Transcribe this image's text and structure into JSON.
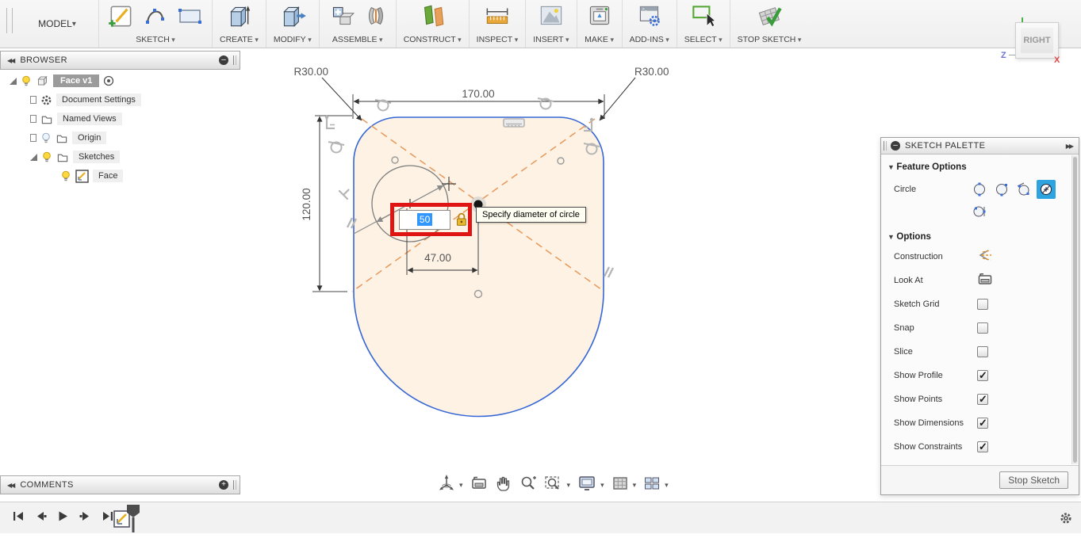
{
  "toolbar": {
    "model_label": "MODEL",
    "groups": [
      {
        "label": "SKETCH"
      },
      {
        "label": "CREATE"
      },
      {
        "label": "MODIFY"
      },
      {
        "label": "ASSEMBLE"
      },
      {
        "label": "CONSTRUCT"
      },
      {
        "label": "INSPECT"
      },
      {
        "label": "INSERT"
      },
      {
        "label": "MAKE"
      },
      {
        "label": "ADD-INS"
      },
      {
        "label": "SELECT"
      },
      {
        "label": "STOP SKETCH"
      }
    ],
    "icon_names": [
      "create-sketch-icon",
      "spline-icon",
      "rectangle-icon",
      "extrude-icon",
      "press-pull-icon",
      "new-component-icon",
      "joint-icon",
      "construction-plane-icon",
      "measure-icon",
      "insert-image-icon",
      "3d-print-icon",
      "scripts-addins-icon",
      "window-select-icon",
      "stop-sketch-icon"
    ]
  },
  "viewcube": {
    "face_label": "RIGHT",
    "z_label": "Z",
    "x_label": "X"
  },
  "browser": {
    "title": "BROWSER",
    "root_label": "Face v1",
    "items": [
      {
        "label": "Document Settings"
      },
      {
        "label": "Named Views"
      },
      {
        "label": "Origin"
      },
      {
        "label": "Sketches"
      },
      {
        "label": "Face"
      }
    ]
  },
  "comments": {
    "title": "COMMENTS"
  },
  "sketch": {
    "width_dim": "170.00",
    "height_dim": "120.00",
    "offset_dim": "47.00",
    "radius_dim_left": "R30.00",
    "radius_dim_right": "R30.00",
    "input_value": "50",
    "tooltip": "Specify diameter of circle"
  },
  "palette": {
    "title": "SKETCH PALETTE",
    "feature_section": "Feature Options",
    "feature_label": "Circle",
    "circle_options": [
      "center-diameter-circle",
      "two-point-circle",
      "three-point-circle",
      "two-tangent-circle",
      "three-tangent-circle"
    ],
    "selected_circle_option": 3,
    "options_section": "Options",
    "options": [
      {
        "label": "Construction",
        "type": "icon"
      },
      {
        "label": "Look At",
        "type": "icon"
      },
      {
        "label": "Sketch Grid",
        "checked": false
      },
      {
        "label": "Snap",
        "checked": false
      },
      {
        "label": "Slice",
        "checked": false
      },
      {
        "label": "Show Profile",
        "checked": true
      },
      {
        "label": "Show Points",
        "checked": true
      },
      {
        "label": "Show Dimensions",
        "checked": true
      },
      {
        "label": "Show Constraints",
        "checked": true
      }
    ],
    "stop_button": "Stop Sketch"
  },
  "nav_icons": [
    "orbit-icon",
    "look-at-icon",
    "pan-icon",
    "zoom-icon",
    "fit-icon",
    "display-settings-icon",
    "grid-settings-icon",
    "viewports-icon"
  ],
  "timeline_icons": [
    "go-to-start-icon",
    "step-back-icon",
    "play-icon",
    "step-forward-icon",
    "go-to-end-icon",
    "sketch-feature-icon",
    "timeline-marker",
    "gear-icon"
  ],
  "colors": {
    "accent_blue": "#2da4e0",
    "profile_fill": "#fdf2e3",
    "profile_stroke": "#3566d6",
    "construction_orange": "#e8985a",
    "highlight_red": "#de1513",
    "selection_blue": "#3297fd",
    "constraint_gray": "#b5b5b5"
  }
}
